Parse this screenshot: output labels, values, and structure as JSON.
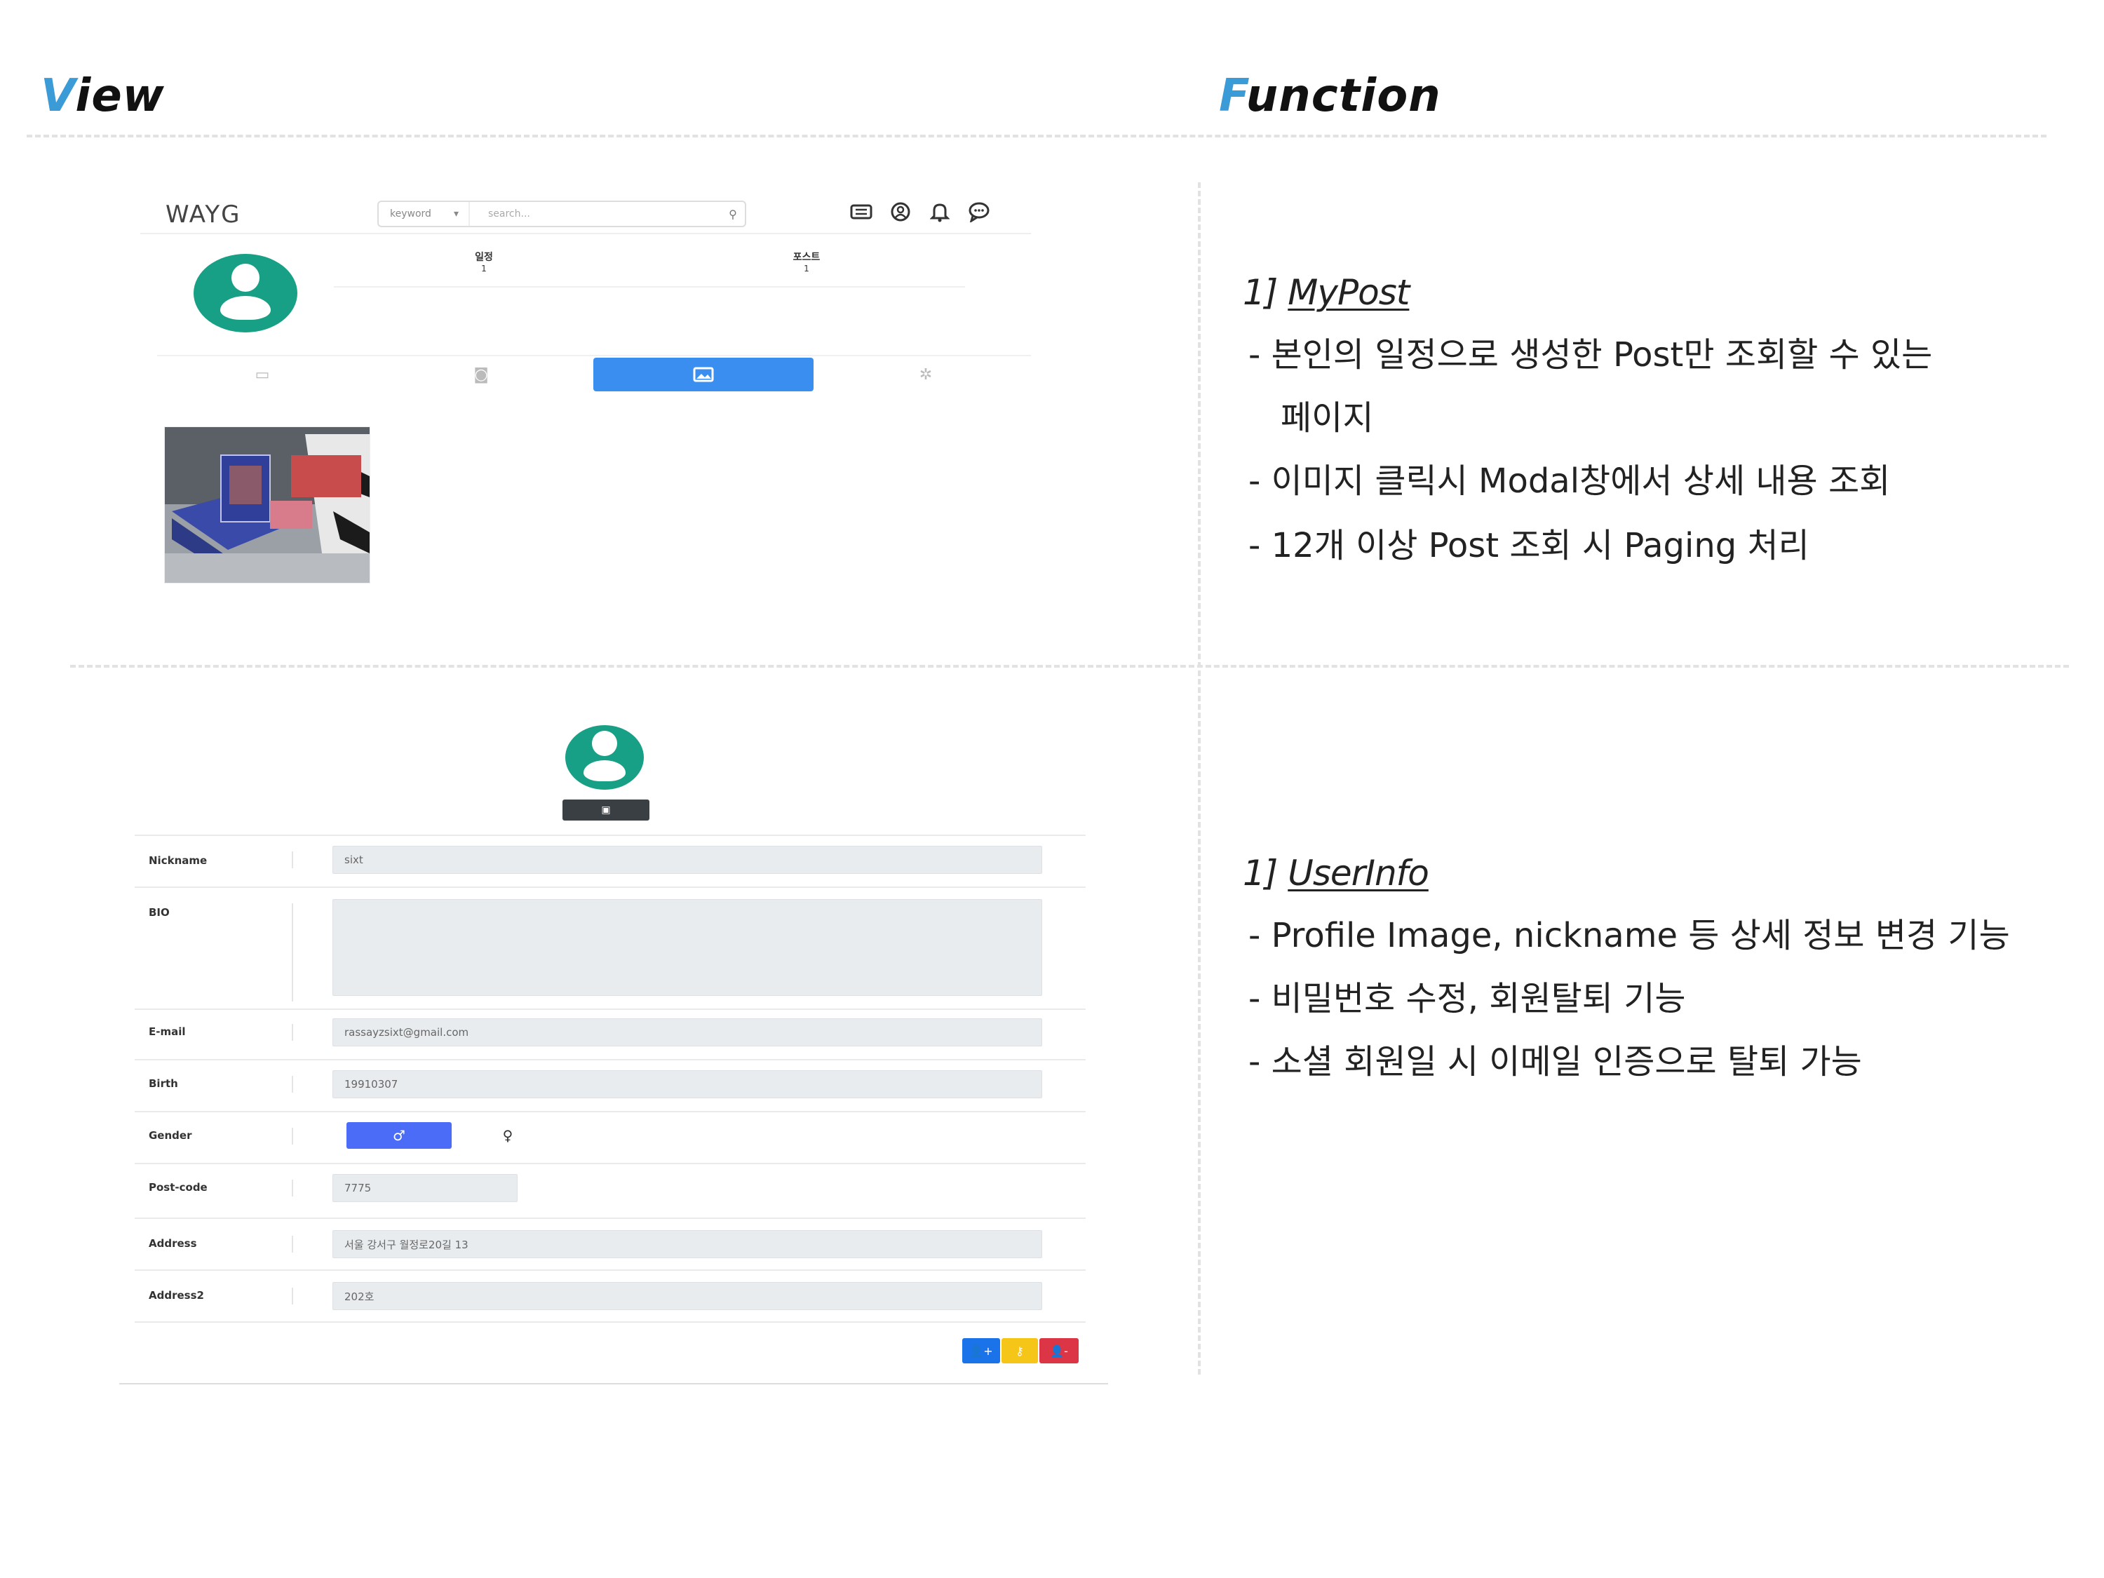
{
  "headings": {
    "view_first": "V",
    "view_rest": "iew",
    "function_first": "F",
    "function_rest": "unction"
  },
  "mypost": {
    "logo": "WAYG",
    "search": {
      "dropdown_value": "keyword",
      "placeholder": "search..."
    },
    "nav_icons": [
      "list-icon",
      "user-circle-icon",
      "bell-icon",
      "chat-icon"
    ],
    "stats": [
      {
        "label": "일정",
        "value": "1"
      },
      {
        "label": "포스트",
        "value": "1"
      }
    ],
    "tabs": [
      {
        "icon": "calendar-icon",
        "active": false
      },
      {
        "icon": "camera-icon",
        "active": false
      },
      {
        "icon": "image-icon",
        "active": true
      },
      {
        "icon": "gear-icon",
        "active": false
      }
    ],
    "accent_color": "#3a8ef0",
    "avatar_color": "#17a085"
  },
  "userinfo": {
    "fields": {
      "nickname": {
        "label": "Nickname",
        "value": "sixt"
      },
      "bio": {
        "label": "BIO",
        "value": ""
      },
      "email": {
        "label": "E-mail",
        "value": "rassayzsixt@gmail.com"
      },
      "birth": {
        "label": "Birth",
        "value": "19910307"
      },
      "gender": {
        "label": "Gender",
        "male_symbol": "♂",
        "female_symbol": "♀"
      },
      "postcode": {
        "label": "Post-code",
        "value": "7775"
      },
      "address": {
        "label": "Address",
        "value": "서울 강서구 월정로20길 13"
      },
      "address2": {
        "label": "Address2",
        "value": "202호"
      }
    },
    "buttons": [
      {
        "name": "edit-user-button",
        "color": "#1a73e8"
      },
      {
        "name": "change-password-button",
        "color": "#f5c518"
      },
      {
        "name": "withdraw-button",
        "color": "#dc3545"
      }
    ]
  },
  "functions": {
    "mypost": {
      "number": "1]",
      "title": "MyPost",
      "lines": [
        "- 본인의 일정으로 생성한 Post만 조회할 수 있는",
        "페이지",
        "- 이미지 클릭시 Modal창에서 상세 내용 조회",
        "- 12개 이상 Post 조회 시 Paging 처리"
      ]
    },
    "userinfo": {
      "number": "1]",
      "title": "UserInfo",
      "lines": [
        "- Profile Image, nickname 등 상세 정보 변경 기능",
        "- 비밀번호 수정, 회원탈퇴 기능",
        "- 소셜 회원일 시 이메일 인증으로 탈퇴 가능"
      ]
    }
  }
}
